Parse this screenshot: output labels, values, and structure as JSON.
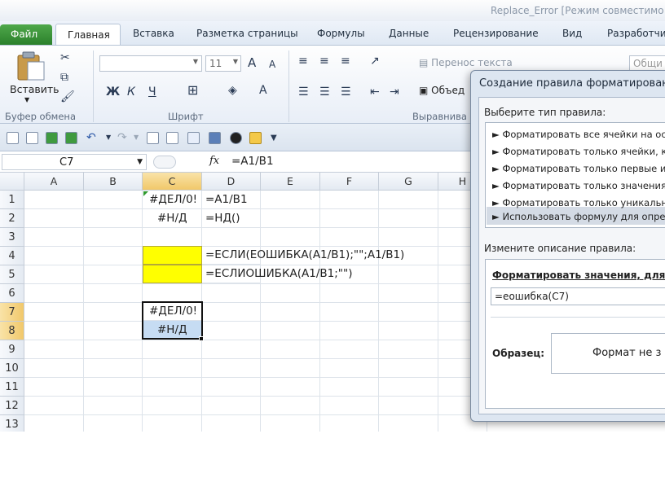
{
  "window": {
    "title": "Replace_Error [Режим совместимо"
  },
  "tabs": {
    "file": "Файл",
    "home": "Главная",
    "others": [
      "Вставка",
      "Разметка страницы",
      "Формулы",
      "Данные",
      "Рецензирование",
      "Вид",
      "Разработчи"
    ]
  },
  "ribbon": {
    "clipboard": {
      "paste_label": "Вставить",
      "group_label": "Буфер обмена"
    },
    "font": {
      "size": "11",
      "bold": "Ж",
      "italic": "К",
      "underline": "Ч",
      "grow": "A",
      "shrink": "A",
      "color_letter": "A",
      "group_label": "Шрифт"
    },
    "alignment": {
      "wrap_label": "Перенос текста",
      "merge_label": "Объед",
      "group_label": "Выравнива"
    },
    "number": {
      "format_label": "Общи"
    }
  },
  "formula_bar": {
    "cell_ref": "C7",
    "fx": "fx",
    "formula": "=A1/B1"
  },
  "sheet": {
    "columns": [
      "A",
      "B",
      "C",
      "D",
      "E",
      "F",
      "G",
      "H"
    ],
    "rows": [
      "1",
      "2",
      "3",
      "4",
      "5",
      "6",
      "7",
      "8",
      "9",
      "10",
      "11",
      "12",
      "13"
    ],
    "c1": "#ДЕЛ/0!",
    "d1": "=A1/B1",
    "c2": "#Н/Д",
    "d2": "=НД()",
    "d4": "=ЕСЛИ(ЕОШИБКА(A1/B1);\"\";A1/B1)",
    "d5": "=ЕСЛИОШИБКА(A1/B1;\"\")",
    "c7": "#ДЕЛ/0!",
    "c8": "#Н/Д",
    "highlight_color": "#ffff00",
    "selection_color": "#c6dcf3"
  },
  "dialog": {
    "title": "Создание правила форматирования",
    "select_type_label": "Выберите тип правила:",
    "rule_types": [
      "► Форматировать все ячейки на осн",
      "► Форматировать только ячейки, ко",
      "► Форматировать только первые ил",
      "► Форматировать только значения,",
      "► Форматировать только уникальны",
      "► Использовать формулу для опред"
    ],
    "edit_desc_label": "Измените описание правила:",
    "format_values_label": "Форматировать значения, для к",
    "formula_value": "=еошибка(C7)",
    "preview_label": "Образец:",
    "preview_text": "Формат не з"
  }
}
